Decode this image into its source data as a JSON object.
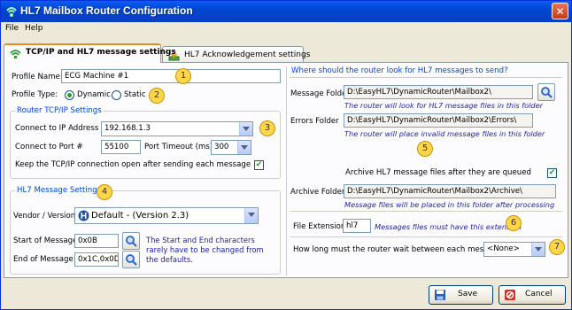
{
  "window": {
    "title": "HL7 Mailbox Router Configuration",
    "close_glyph": "✕"
  },
  "menu": {
    "items": [
      "File",
      "Help"
    ]
  },
  "tabs": [
    {
      "label": "TCP/IP and HL7 message settings",
      "icon": "network-icon",
      "active": true
    },
    {
      "label": "HL7 Acknowledgement settings",
      "icon": "acknowledgement-icon",
      "active": false
    }
  ],
  "profile": {
    "name_label": "Profile Name:",
    "name_value": "ECG Machine #1",
    "type_label": "Profile Type:",
    "dynamic_label": "Dynamic",
    "static_label": "Static",
    "selected_type": "Dynamic"
  },
  "tcpip": {
    "group_title": "Router TCP/IP Settings",
    "ip_label": "Connect to IP Address",
    "ip_value": "192.168.1.3",
    "port_label": "Connect to Port #",
    "port_value": "55100",
    "timeout_label": "Port Timeout (ms)",
    "timeout_value": "300",
    "keep_open_label": "Keep the TCP/IP connection open after sending each message",
    "keep_open_checked": true
  },
  "hl7": {
    "group_title": "HL7 Message Settings",
    "vendor_label": "Vendor / Version",
    "vendor_value": "Default - (Version 2.3)",
    "start_label": "Start of Message",
    "start_value": "0x0B",
    "end_label": "End  of Message",
    "end_value": "0x1C,0x0D",
    "hint": "The Start and End characters rarely have to be changed from the defaults."
  },
  "folders": {
    "group_title": "Where should the router look for HL7 messages to send?",
    "message_label": "Message Folder",
    "message_value": "D:\\EasyHL7\\DynamicRouter\\Mailbox2\\",
    "message_hint": "The router will look for HL7 message files in this folder",
    "errors_label": "Errors Folder",
    "errors_value": "D:\\EasyHL7\\DynamicRouter\\Mailbox2\\Errors\\",
    "errors_hint": "The router will place invalid message files in this folder",
    "archive_check_label": "Archive HL7 message files after they are queued",
    "archive_checked": true,
    "archive_label": "Archive Folder",
    "archive_value": "D:\\EasyHL7\\DynamicRouter\\Mailbox2\\Archive\\",
    "archive_hint": "Message files will be placed in this folder after processing",
    "ext_label": "File Extension",
    "ext_value": "hl7",
    "ext_hint": "Messages files must have this extension",
    "wait_label": "How long must the router wait between each message",
    "wait_value": "<None>"
  },
  "callouts": [
    "1",
    "2",
    "3",
    "4",
    "5",
    "6",
    "7"
  ],
  "buttons": {
    "save": "Save",
    "cancel": "Cancel"
  },
  "check_glyph": "✔",
  "colors": {
    "titlebar": "#0a5ef2",
    "group_title": "#0046d5",
    "hint": "#1f1fa8",
    "callout": "#ffd54a",
    "checkmark": "#21a121"
  }
}
